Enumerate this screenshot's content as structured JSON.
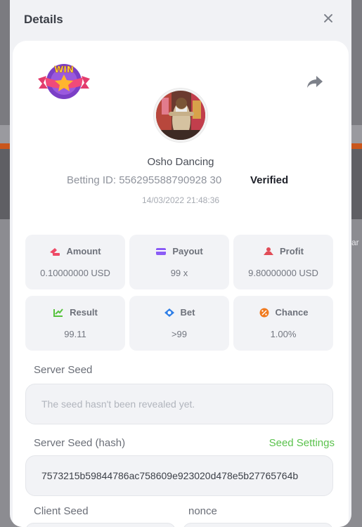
{
  "background": {
    "right_text": "ar"
  },
  "modal": {
    "title": "Details",
    "game": {
      "name": "Osho Dancing",
      "betting_id_label": "Betting ID:",
      "betting_id": "556295588790928 30",
      "verified": "Verified",
      "timestamp": "14/03/2022 21:48:36",
      "badge_text": "WIN"
    },
    "stats": [
      {
        "label": "Amount",
        "value": "0.10000000 USD",
        "icon": "money-icon",
        "color": "#ee4a66"
      },
      {
        "label": "Payout",
        "value": "99 x",
        "icon": "card-icon",
        "color": "#8b5cf6"
      },
      {
        "label": "Profit",
        "value": "9.80000000 USD",
        "icon": "profit-icon",
        "color": "#e14c57"
      },
      {
        "label": "Result",
        "value": "99.11",
        "icon": "result-icon",
        "color": "#56c23d"
      },
      {
        "label": "Bet",
        "value": ">99",
        "icon": "bet-icon",
        "color": "#2f7ee6"
      },
      {
        "label": "Chance",
        "value": "1.00%",
        "icon": "chance-icon",
        "color": "#f07a1e"
      }
    ],
    "server_seed": {
      "label": "Server Seed",
      "placeholder": "The seed hasn't been revealed yet."
    },
    "server_seed_hash": {
      "label": "Server Seed (hash)",
      "link": "Seed Settings",
      "value": "7573215b59844786ac758609e923020d478e5b27765764b"
    },
    "client_seed": {
      "label": "Client Seed"
    },
    "nonce": {
      "label": "nonce"
    }
  }
}
